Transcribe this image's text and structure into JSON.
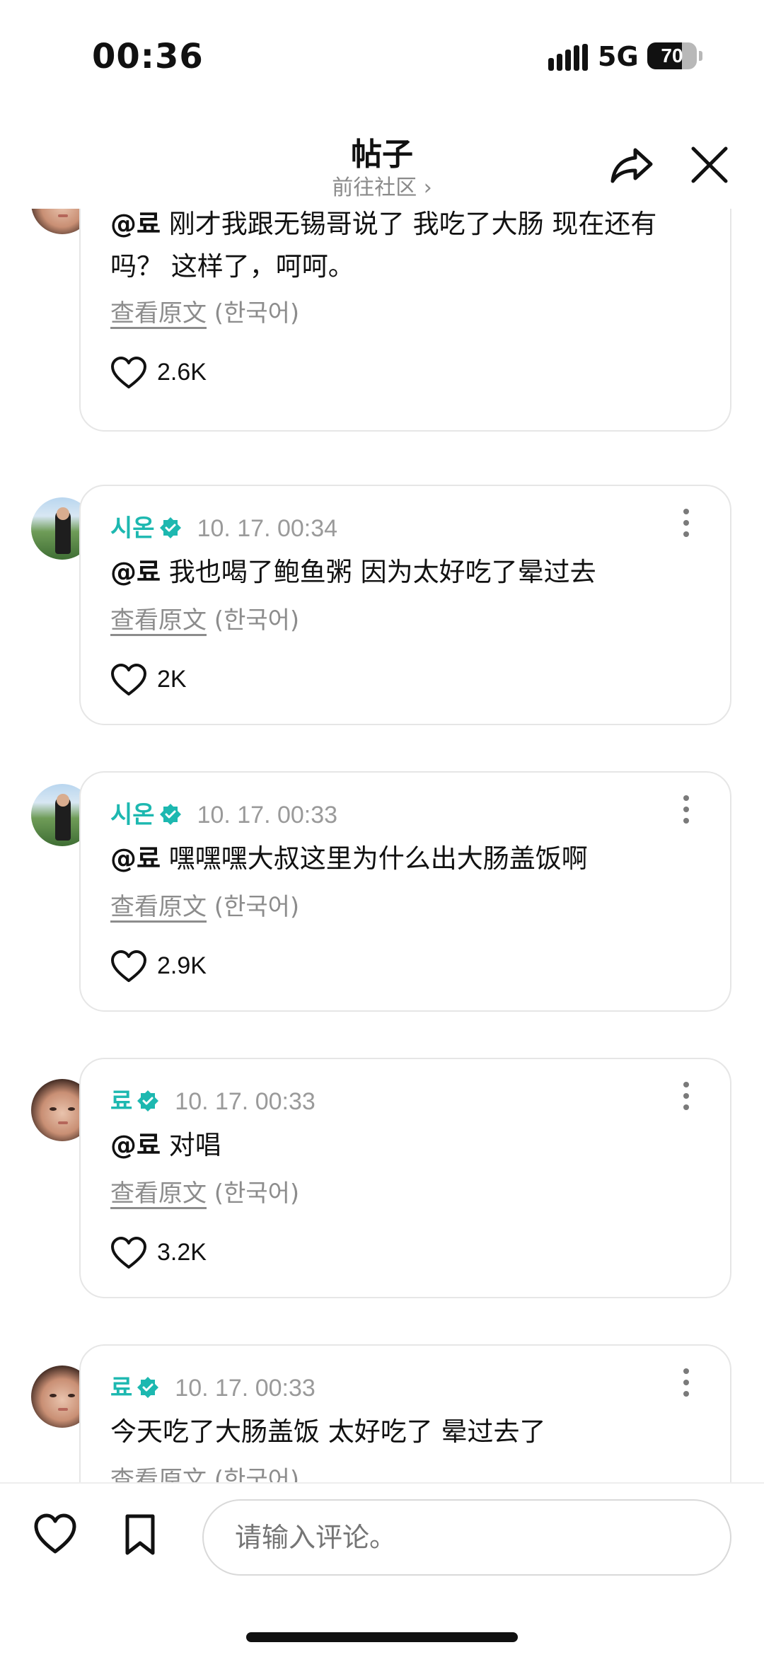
{
  "status_bar": {
    "time": "00:36",
    "network": "5G",
    "battery": "70",
    "battery_level": 0.7
  },
  "header": {
    "title": "帖子",
    "subtitle": "前往社区 ›"
  },
  "comments": [
    {
      "author": "",
      "verified": false,
      "time": "",
      "mention": "@료",
      "text": " 刚才我跟无锡哥说了 我吃了大肠 现在还有吗？ 这样了，呵呵。",
      "translate_link": "查看原文",
      "translate_lang": " (한국어)",
      "likes": "2.6K",
      "avatar": "face-avatar"
    },
    {
      "author": "시온",
      "verified": true,
      "time": "10. 17. 00:34",
      "mention": "@료",
      "text": " 我也喝了鲍鱼粥 因为太好吃了晕过去",
      "translate_link": "查看原文",
      "translate_lang": " (한국어)",
      "likes": "2K",
      "avatar": "outdoor-avatar"
    },
    {
      "author": "시온",
      "verified": true,
      "time": "10. 17. 00:33",
      "mention": "@료",
      "text": " 嘿嘿嘿大叔这里为什么出大肠盖饭啊",
      "translate_link": "查看原文",
      "translate_lang": " (한국어)",
      "likes": "2.9K",
      "avatar": "outdoor-avatar"
    },
    {
      "author": "료",
      "verified": true,
      "time": "10. 17. 00:33",
      "mention": "@료",
      "text": " 对唱",
      "translate_link": "查看原文",
      "translate_lang": " (한국어)",
      "likes": "3.2K",
      "avatar": "face-avatar"
    },
    {
      "author": "료",
      "verified": true,
      "time": "10. 17. 00:33",
      "mention": "",
      "text": "今天吃了大肠盖饭 太好吃了 晕过去了",
      "translate_link": "查看原文",
      "translate_lang": " (한국어)",
      "likes": "",
      "avatar": "face-avatar"
    }
  ],
  "bottom_bar": {
    "input_placeholder": "请输入评论。"
  },
  "colors": {
    "accent": "#1db8b0",
    "text": "#111111",
    "muted": "#8c8c8c",
    "border": "#e6e6e6"
  },
  "icons": [
    "signal-icon",
    "share-icon",
    "close-icon",
    "verified-badge-icon",
    "more-vertical-icon",
    "heart-icon",
    "bookmark-icon"
  ]
}
